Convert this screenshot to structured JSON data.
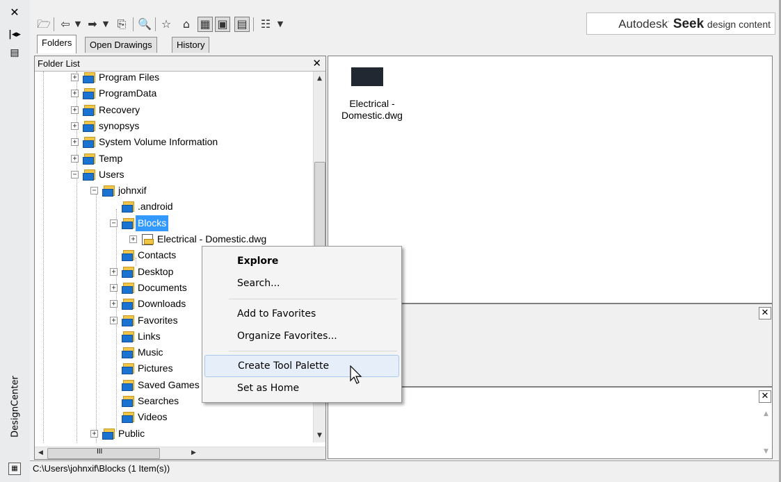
{
  "app": {
    "vertical_title": "DesignCenter",
    "brand": {
      "company": "Autodesk",
      "product": "Seek",
      "tagline": "design content"
    }
  },
  "left_strip": {
    "icons": [
      "close-icon",
      "autohide-icon",
      "properties-icon"
    ]
  },
  "toolbar": {
    "icons": [
      "load-icon",
      "back-icon",
      "back-dropdown-icon",
      "forward-icon",
      "forward-dropdown-icon",
      "up-icon",
      "search-icon",
      "favorites-icon",
      "home-icon",
      "tree-toggle-icon",
      "preview-toggle-icon",
      "description-toggle-icon",
      "views-icon",
      "views-dropdown-icon"
    ]
  },
  "tabs": [
    {
      "label": "Folders",
      "active": true
    },
    {
      "label": "Open Drawings",
      "active": false
    },
    {
      "label": "History",
      "active": false
    }
  ],
  "tree": {
    "header": "Folder List",
    "items": [
      {
        "label": "Program Files",
        "level": 0,
        "expander": "+"
      },
      {
        "label": "ProgramData",
        "level": 0,
        "expander": "+"
      },
      {
        "label": "Recovery",
        "level": 0,
        "expander": "+"
      },
      {
        "label": "synopsys",
        "level": 0,
        "expander": "+"
      },
      {
        "label": "System Volume Information",
        "level": 0,
        "expander": "+"
      },
      {
        "label": "Temp",
        "level": 0,
        "expander": "+"
      },
      {
        "label": "Users",
        "level": 0,
        "expander": "-"
      },
      {
        "label": "johnxif",
        "level": 1,
        "expander": "-"
      },
      {
        "label": ".android",
        "level": 2,
        "expander": ""
      },
      {
        "label": "Blocks",
        "level": 2,
        "expander": "-",
        "selected": true
      },
      {
        "label": "Electrical - Domestic.dwg",
        "level": 3,
        "expander": "+",
        "file": true
      },
      {
        "label": "Contacts",
        "level": 2,
        "expander": ""
      },
      {
        "label": "Desktop",
        "level": 2,
        "expander": "+"
      },
      {
        "label": "Documents",
        "level": 2,
        "expander": "+"
      },
      {
        "label": "Downloads",
        "level": 2,
        "expander": "+"
      },
      {
        "label": "Favorites",
        "level": 2,
        "expander": "+"
      },
      {
        "label": "Links",
        "level": 2,
        "expander": ""
      },
      {
        "label": "Music",
        "level": 2,
        "expander": ""
      },
      {
        "label": "Pictures",
        "level": 2,
        "expander": ""
      },
      {
        "label": "Saved Games",
        "level": 2,
        "expander": ""
      },
      {
        "label": "Searches",
        "level": 2,
        "expander": ""
      },
      {
        "label": "Videos",
        "level": 2,
        "expander": ""
      },
      {
        "label": "Public",
        "level": 1,
        "expander": "+"
      }
    ],
    "hscroll_text": "III"
  },
  "content": {
    "files": [
      {
        "name": "Electrical - Domestic.dwg"
      }
    ]
  },
  "context_menu": {
    "items": [
      "Explore",
      "Search...",
      "Add to Favorites",
      "Organize Favorites...",
      "Create Tool Palette",
      "Set as Home"
    ],
    "bold_item": "Explore",
    "hovered_item": "Create Tool Palette"
  },
  "status": {
    "path": "C:\\Users\\johnxif\\Blocks (1 Item(s))"
  },
  "colors": {
    "selection": "#3399ff",
    "folder_yellow": "#f0c64a",
    "folder_blue": "#1a73d0",
    "menu_hover": "#e5eef9"
  }
}
